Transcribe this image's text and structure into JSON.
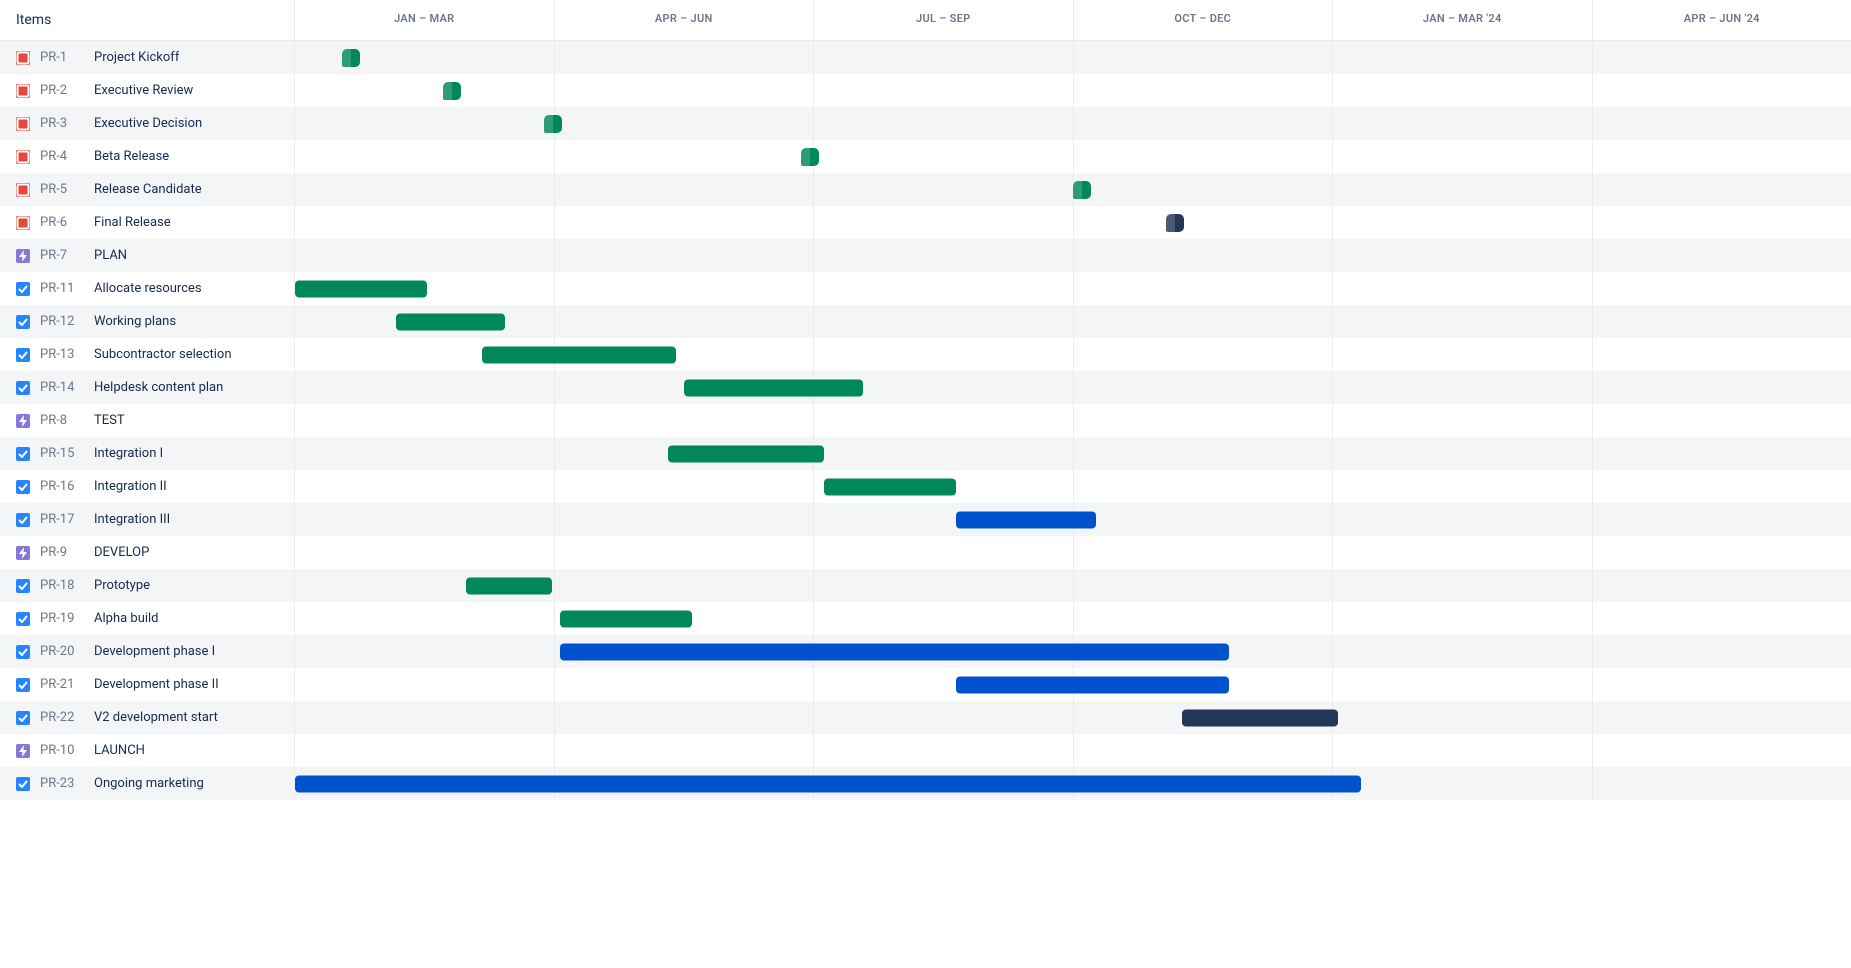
{
  "header": {
    "items_label": "Items",
    "periods": [
      "JAN – MAR",
      "APR – JUN",
      "JUL – SEP",
      "OCT – DEC",
      "JAN – MAR '24",
      "APR – JUN '24"
    ]
  },
  "rows": [
    {
      "key": "PR-1",
      "summary": "Project Kickoff",
      "type": "milestone",
      "shape": "milestone",
      "color": "green",
      "start": 3.0
    },
    {
      "key": "PR-2",
      "summary": "Executive Review",
      "type": "milestone",
      "shape": "milestone",
      "color": "green",
      "start": 9.5
    },
    {
      "key": "PR-3",
      "summary": "Executive Decision",
      "type": "milestone",
      "shape": "milestone",
      "color": "green",
      "start": 16.0
    },
    {
      "key": "PR-4",
      "summary": "Beta Release",
      "type": "milestone",
      "shape": "milestone",
      "color": "green",
      "start": 32.5
    },
    {
      "key": "PR-5",
      "summary": "Release Candidate",
      "type": "milestone",
      "shape": "milestone",
      "color": "green",
      "start": 50.0
    },
    {
      "key": "PR-6",
      "summary": "Final Release",
      "type": "milestone",
      "shape": "milestone",
      "color": "navy",
      "start": 56.0
    },
    {
      "key": "PR-7",
      "summary": "PLAN",
      "type": "epic"
    },
    {
      "key": "PR-11",
      "summary": "Allocate resources",
      "type": "task",
      "shape": "bar",
      "color": "green",
      "start": 0.0,
      "width": 8.5
    },
    {
      "key": "PR-12",
      "summary": "Working plans",
      "type": "task",
      "shape": "bar",
      "color": "green",
      "start": 6.5,
      "width": 7.0
    },
    {
      "key": "PR-13",
      "summary": "Subcontractor selection",
      "type": "task",
      "shape": "bar",
      "color": "green",
      "start": 12.0,
      "width": 12.5
    },
    {
      "key": "PR-14",
      "summary": "Helpdesk content plan",
      "type": "task",
      "shape": "bar",
      "color": "green",
      "start": 25.0,
      "width": 11.5
    },
    {
      "key": "PR-8",
      "summary": "TEST",
      "type": "epic"
    },
    {
      "key": "PR-15",
      "summary": "Integration I",
      "type": "task",
      "shape": "bar",
      "color": "green",
      "start": 24.0,
      "width": 10.0
    },
    {
      "key": "PR-16",
      "summary": "Integration II",
      "type": "task",
      "shape": "bar",
      "color": "green",
      "start": 34.0,
      "width": 8.5
    },
    {
      "key": "PR-17",
      "summary": "Integration III",
      "type": "task",
      "shape": "bar",
      "color": "blue",
      "start": 42.5,
      "width": 9.0
    },
    {
      "key": "PR-9",
      "summary": "DEVELOP",
      "type": "epic"
    },
    {
      "key": "PR-18",
      "summary": "Prototype",
      "type": "task",
      "shape": "bar",
      "color": "green",
      "start": 11.0,
      "width": 5.5
    },
    {
      "key": "PR-19",
      "summary": "Alpha build",
      "type": "task",
      "shape": "bar",
      "color": "green",
      "start": 17.0,
      "width": 8.5
    },
    {
      "key": "PR-20",
      "summary": "Development phase I",
      "type": "task",
      "shape": "bar",
      "color": "blue",
      "start": 17.0,
      "width": 43.0
    },
    {
      "key": "PR-21",
      "summary": "Development phase II",
      "type": "task",
      "shape": "bar",
      "color": "blue",
      "start": 42.5,
      "width": 17.5
    },
    {
      "key": "PR-22",
      "summary": "V2 development start",
      "type": "task",
      "shape": "bar",
      "color": "navy",
      "start": 57.0,
      "width": 10.0
    },
    {
      "key": "PR-10",
      "summary": "LAUNCH",
      "type": "epic"
    },
    {
      "key": "PR-23",
      "summary": "Ongoing marketing",
      "type": "task",
      "shape": "bar",
      "color": "blue",
      "start": 0.0,
      "width": 68.5
    }
  ],
  "icons": {
    "milestone": "milestone-icon",
    "epic": "epic-icon",
    "task": "task-icon"
  },
  "chart_data": {
    "type": "gantt",
    "time_axis": [
      "JAN – MAR",
      "APR – JUN",
      "JUL – SEP",
      "OCT – DEC",
      "JAN – MAR '24",
      "APR – JUN '24"
    ],
    "unit": "percent_of_timeline",
    "tasks": [
      {
        "id": "PR-1",
        "name": "Project Kickoff",
        "kind": "milestone",
        "at": 3.0,
        "status": "done"
      },
      {
        "id": "PR-2",
        "name": "Executive Review",
        "kind": "milestone",
        "at": 9.5,
        "status": "done"
      },
      {
        "id": "PR-3",
        "name": "Executive Decision",
        "kind": "milestone",
        "at": 16.0,
        "status": "done"
      },
      {
        "id": "PR-4",
        "name": "Beta Release",
        "kind": "milestone",
        "at": 32.5,
        "status": "done"
      },
      {
        "id": "PR-5",
        "name": "Release Candidate",
        "kind": "milestone",
        "at": 50.0,
        "status": "done"
      },
      {
        "id": "PR-6",
        "name": "Final Release",
        "kind": "milestone",
        "at": 56.0,
        "status": "todo"
      },
      {
        "id": "PR-7",
        "name": "PLAN",
        "kind": "group"
      },
      {
        "id": "PR-11",
        "name": "Allocate resources",
        "kind": "task",
        "start": 0.0,
        "end": 8.5,
        "status": "done"
      },
      {
        "id": "PR-12",
        "name": "Working plans",
        "kind": "task",
        "start": 6.5,
        "end": 13.5,
        "status": "done"
      },
      {
        "id": "PR-13",
        "name": "Subcontractor selection",
        "kind": "task",
        "start": 12.0,
        "end": 24.5,
        "status": "done"
      },
      {
        "id": "PR-14",
        "name": "Helpdesk content plan",
        "kind": "task",
        "start": 25.0,
        "end": 36.5,
        "status": "done"
      },
      {
        "id": "PR-8",
        "name": "TEST",
        "kind": "group"
      },
      {
        "id": "PR-15",
        "name": "Integration I",
        "kind": "task",
        "start": 24.0,
        "end": 34.0,
        "status": "done"
      },
      {
        "id": "PR-16",
        "name": "Integration II",
        "kind": "task",
        "start": 34.0,
        "end": 42.5,
        "status": "done"
      },
      {
        "id": "PR-17",
        "name": "Integration III",
        "kind": "task",
        "start": 42.5,
        "end": 51.5,
        "status": "in_progress"
      },
      {
        "id": "PR-9",
        "name": "DEVELOP",
        "kind": "group"
      },
      {
        "id": "PR-18",
        "name": "Prototype",
        "kind": "task",
        "start": 11.0,
        "end": 16.5,
        "status": "done"
      },
      {
        "id": "PR-19",
        "name": "Alpha build",
        "kind": "task",
        "start": 17.0,
        "end": 25.5,
        "status": "done"
      },
      {
        "id": "PR-20",
        "name": "Development phase I",
        "kind": "task",
        "start": 17.0,
        "end": 60.0,
        "status": "in_progress"
      },
      {
        "id": "PR-21",
        "name": "Development phase II",
        "kind": "task",
        "start": 42.5,
        "end": 60.0,
        "status": "in_progress"
      },
      {
        "id": "PR-22",
        "name": "V2 development start",
        "kind": "task",
        "start": 57.0,
        "end": 67.0,
        "status": "todo"
      },
      {
        "id": "PR-10",
        "name": "LAUNCH",
        "kind": "group"
      },
      {
        "id": "PR-23",
        "name": "Ongoing marketing",
        "kind": "task",
        "start": 0.0,
        "end": 68.5,
        "status": "in_progress"
      }
    ]
  }
}
